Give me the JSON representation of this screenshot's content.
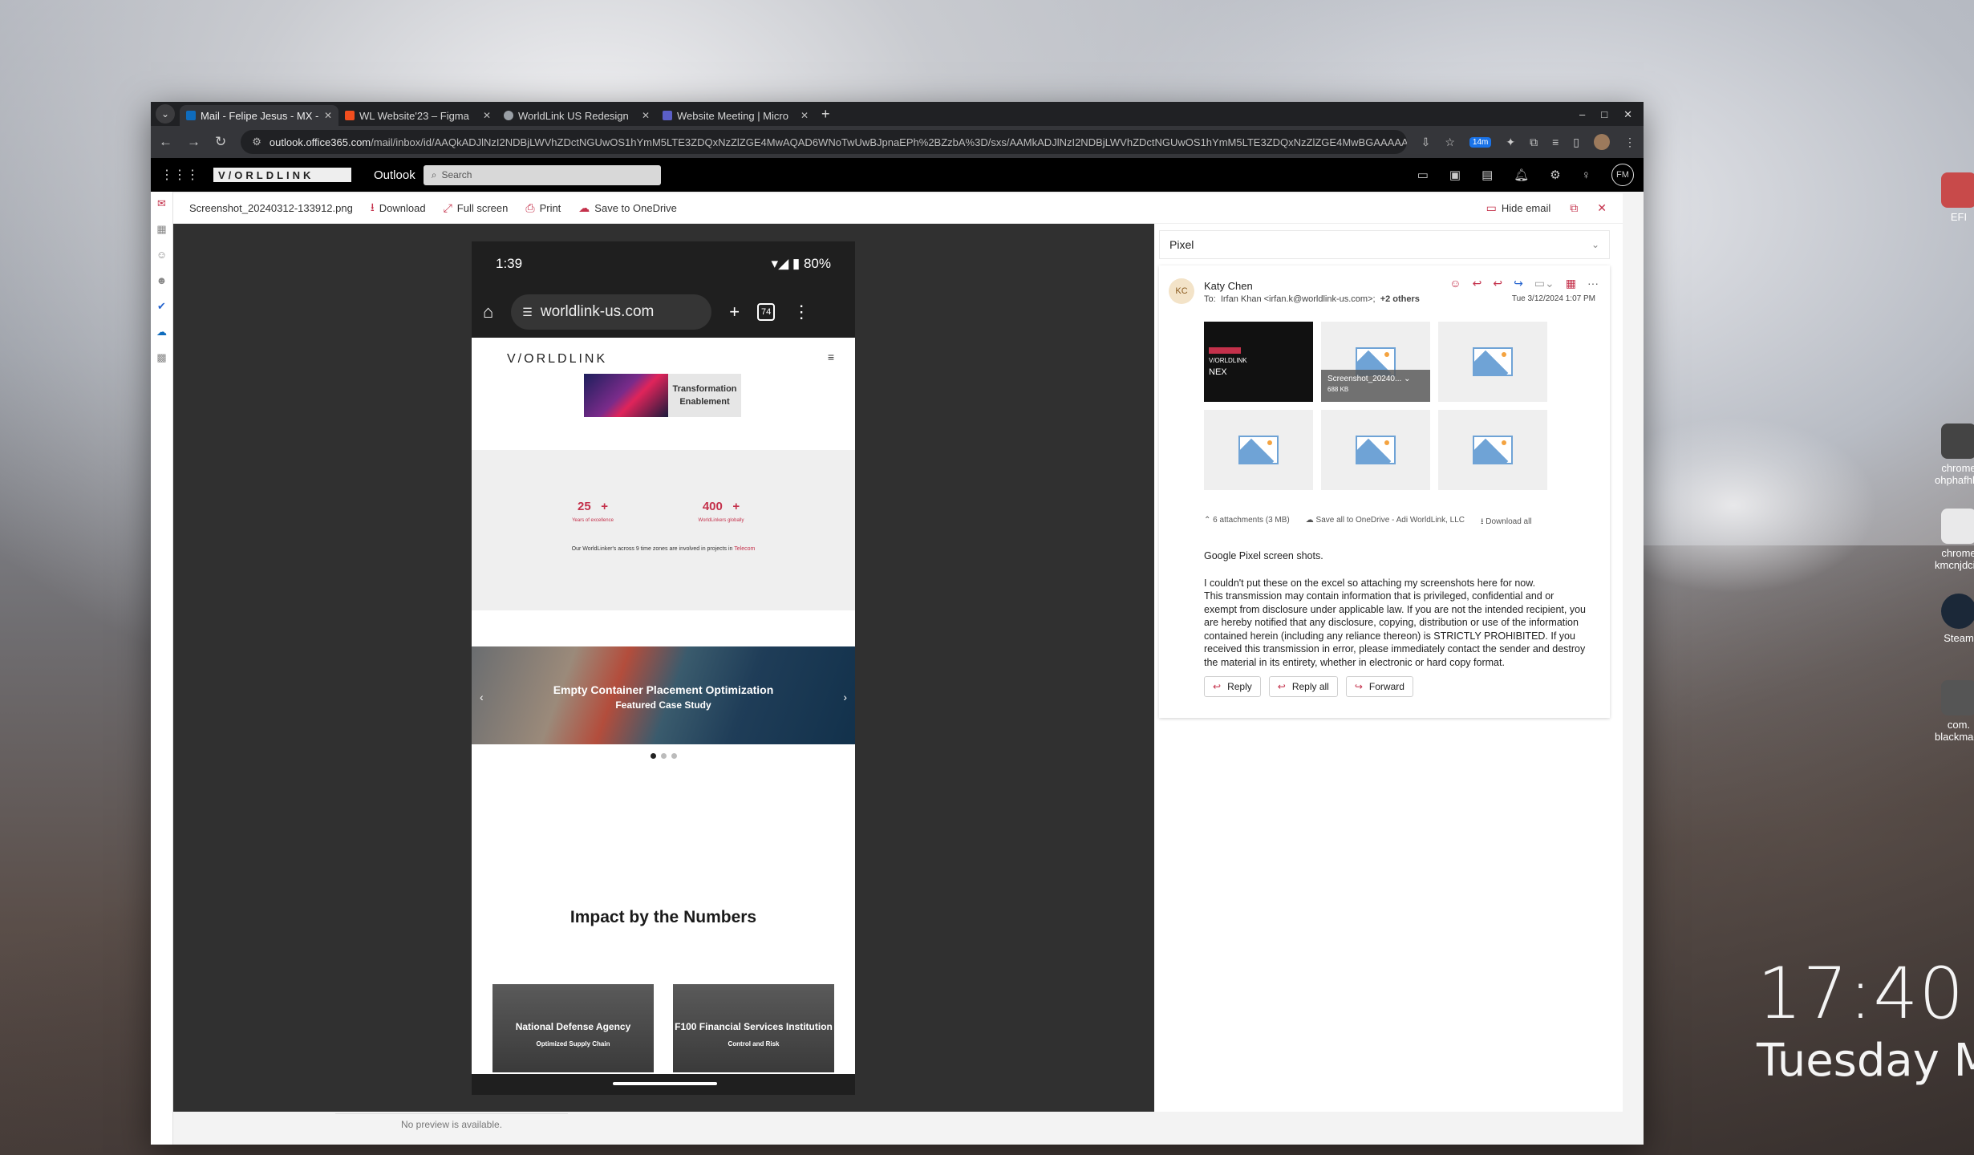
{
  "desktop": {
    "time": "17:40",
    "date": "Tuesday Mar",
    "icons": [
      "EFI",
      "chrome ohphafhlkc",
      "chrome kmcnjdcipr",
      "Steam",
      "com. blackmagic"
    ]
  },
  "browser": {
    "tabs": [
      {
        "label": "Mail - Felipe Jesus - MX -",
        "color": "#0f6cbd"
      },
      {
        "label": "WL Website'23 – Figma",
        "color": "#f24e1e"
      },
      {
        "label": "WorldLink US Redesign",
        "color": "#9aa0a6"
      },
      {
        "label": "Website Meeting | Micro",
        "color": "#5b5fc7"
      }
    ],
    "url_host": "outlook.office365.com",
    "url_path": "/mail/inbox/id/AAQkADJlNzI2NDBjLWVhZDctNGUwOS1hYmM5LTE3ZDQxNzZlZGE4MwAQAD6WNoTwUwBJpnaEPh%2BZzbA%3D/sxs/AAMkADJlNzI2NDBjLWVhZDctNGUwOS1hYmM5LTE3ZDQxNzZlZGE4MwBGAAAAAAD6evkCyS7QRYglzJCTxd...",
    "ext_badge": "14m"
  },
  "outlook": {
    "brand": "V/ORLDLINK",
    "app_name": "Outlook",
    "search_placeholder": "Search",
    "avatar": "FM",
    "no_preview": "No preview is available."
  },
  "viewer": {
    "filename": "Screenshot_20240312-133912.png",
    "download": "Download",
    "fullscreen": "Full screen",
    "print": "Print",
    "save_onedrive": "Save to OneDrive",
    "hide_email": "Hide email"
  },
  "phone": {
    "time": "1:39",
    "battery": "80%",
    "url": "worldlink-us.com",
    "tab_count": "74",
    "logo": "V/ORLDLINK",
    "banner_l1": "Transformation",
    "banner_l2": "Enablement",
    "stat1_num": "25",
    "stat1_cap": "Years of excellence",
    "stat2_num": "400",
    "stat2_cap": "WorldLinkers globally",
    "stat_plus": "+",
    "stats_caption": "Our WorldLinker's across 9 time zones are involved in projects in",
    "stats_caption_em": "Telecom",
    "hero_title": "Empty Container Placement Optimization",
    "hero_sub": "Featured Case Study",
    "impact_title": "Impact by the Numbers",
    "card1": "National Defense Agency",
    "card1_sub": "Optimized Supply Chain",
    "card2": "F100 Financial Services Institution",
    "card2_sub": "Control and Risk"
  },
  "email": {
    "subject": "Pixel",
    "initials": "KC",
    "from": "Katy Chen",
    "to_prefix": "To:",
    "to": "Irfan Khan <irfan.k@worldlink-us.com>;",
    "to_more": "+2 others",
    "date": "Tue 3/12/2024 1:07 PM",
    "attachment_name": "Screenshot_20240...",
    "attachment_size": "688 KB",
    "attachments_summary": "6 attachments (3 MB)",
    "save_all": "Save all to OneDrive - Adi WorldLink, LLC",
    "download_all": "Download all",
    "body_1": "Google Pixel screen shots.",
    "body_2": "I couldn't put these on the excel so attaching my screenshots here for now.",
    "body_3": "This transmission may contain information that is privileged, confidential and or exempt from disclosure under applicable law. If you are not the intended recipient, you are hereby notified that any disclosure, copying, distribution or use of the information contained herein (including any reliance thereon) is STRICTLY PROHIBITED. If you received this transmission in error, please immediately contact the sender and destroy the material in its entirety, whether in electronic or hard copy format.",
    "reply": "Reply",
    "reply_all": "Reply all",
    "forward": "Forward"
  }
}
